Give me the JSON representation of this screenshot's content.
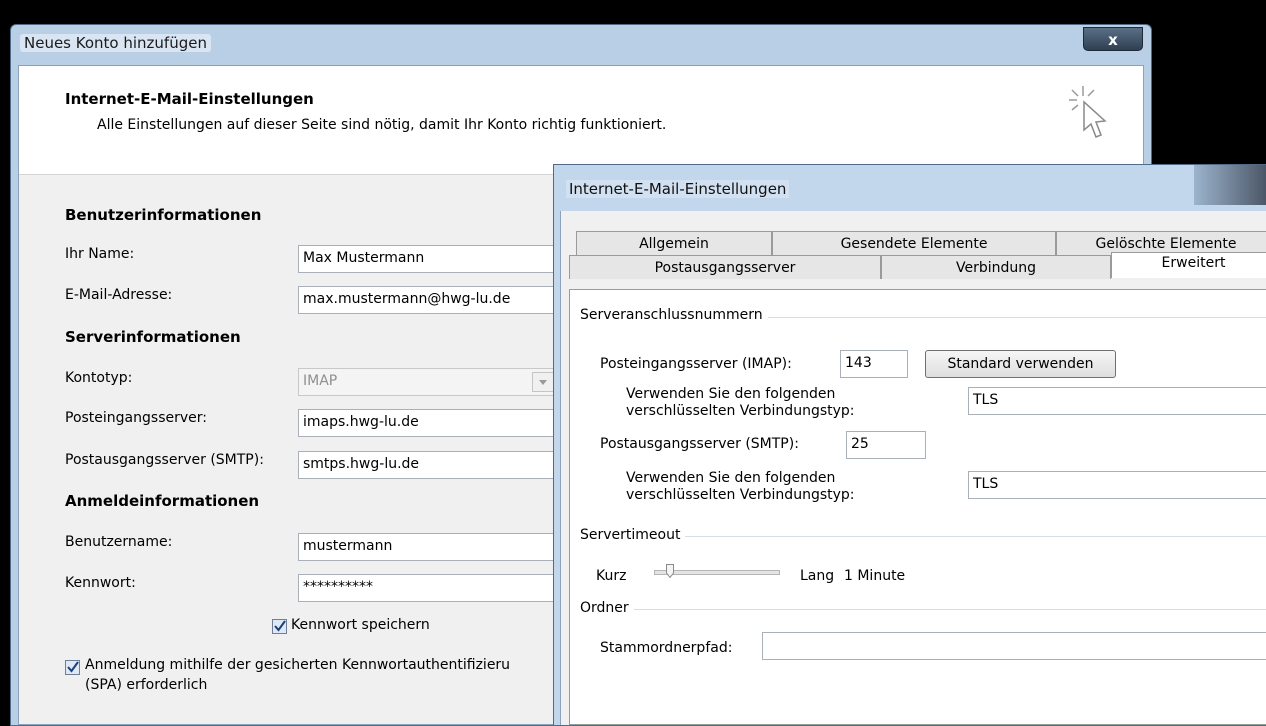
{
  "back_window": {
    "title": "Neues Konto hinzufügen",
    "close_label": "x",
    "header_title": "Internet-E-Mail-Einstellungen",
    "header_subtitle": "Alle Einstellungen auf dieser Seite sind nötig, damit Ihr Konto richtig funktioniert.",
    "sections": {
      "user": "Benutzerinformationen",
      "server": "Serverinformationen",
      "login": "Anmeldeinformationen"
    },
    "fields": {
      "name_label": "Ihr Name:",
      "name_value": "Max Mustermann",
      "email_label": "E-Mail-Adresse:",
      "email_value": "max.mustermann@hwg-lu.de",
      "account_type_label": "Kontotyp:",
      "account_type_value": "IMAP",
      "incoming_label": "Posteingangsserver:",
      "incoming_value": "imaps.hwg-lu.de",
      "outgoing_label": "Postausgangsserver (SMTP):",
      "outgoing_value": "smtps.hwg-lu.de",
      "username_label": "Benutzername:",
      "username_value": "mustermann",
      "password_label": "Kennwort:",
      "password_value": "**********"
    },
    "save_password_label": "Kennwort speichern",
    "save_password_checked": true,
    "spa_label_line1": "Anmeldung mithilfe der gesicherten Kennwortauthentifizieru",
    "spa_label_line2": "(SPA) erforderlich",
    "spa_checked": true
  },
  "dialog": {
    "title": "Internet-E-Mail-Einstellungen",
    "tabs_row1": [
      "Allgemein",
      "Gesendete Elemente",
      "Gelöschte Elemente"
    ],
    "tabs_row2": [
      "Postausgangsserver",
      "Verbindung",
      "Erweitert"
    ],
    "active_tab": "Erweitert",
    "ports_group": "Serveranschlussnummern",
    "incoming_port_label": "Posteingangsserver (IMAP):",
    "incoming_port_value": "143",
    "default_button": "Standard verwenden",
    "enc_label_line1": "Verwenden Sie den folgenden",
    "enc_label_line2": "verschlüsselten Verbindungstyp:",
    "incoming_enc_value": "TLS",
    "outgoing_port_label": "Postausgangsserver (SMTP):",
    "outgoing_port_value": "25",
    "outgoing_enc_value": "TLS",
    "timeout_group": "Servertimeout",
    "timeout_short": "Kurz",
    "timeout_long": "Lang",
    "timeout_value": "1 Minute",
    "timeout_level": 0.1,
    "folders_group": "Ordner",
    "root_path_label": "Stammordnerpfad:",
    "root_path_value": ""
  }
}
